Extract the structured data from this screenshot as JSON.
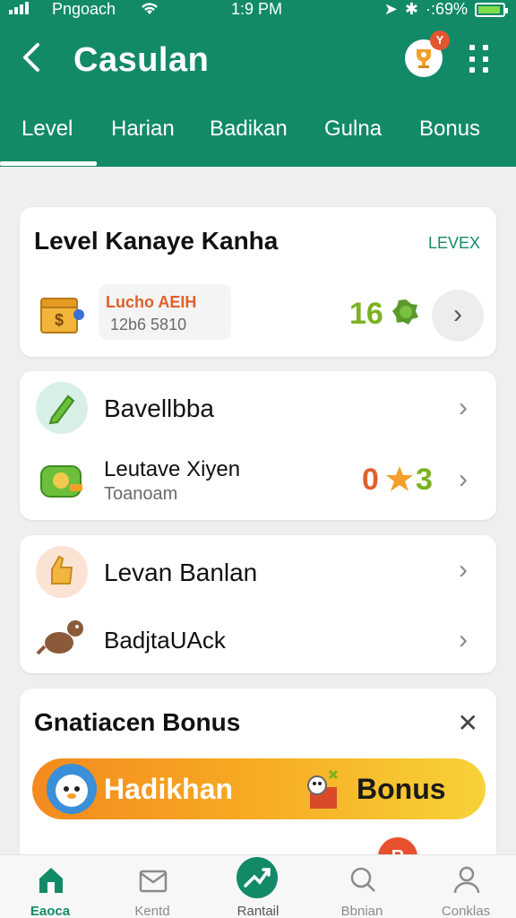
{
  "status_bar": {
    "carrier": "Pngoach",
    "time": "1:9 PM",
    "battery": "·:69%"
  },
  "header": {
    "title": "Casulan",
    "tabs": [
      {
        "label": "Level",
        "active": true
      },
      {
        "label": "Harian",
        "active": false
      },
      {
        "label": "Badikan",
        "active": false
      },
      {
        "label": "Gulna",
        "active": false
      },
      {
        "label": "Bonus",
        "active": false
      }
    ],
    "notification_badge": "Y"
  },
  "level_card": {
    "title": "Level Kanaye Kanha",
    "action": "LEVEX",
    "item_label": "Lucho AEIH",
    "item_sub": " 12b6 5810",
    "value": "16"
  },
  "list_group_1": [
    {
      "label": "Bavellbba",
      "sub": "",
      "value": "",
      "icon": "pencil-icon"
    },
    {
      "label": "Leutave Xiyen",
      "sub": "Toanoam",
      "value_left": "0",
      "value_right": "3",
      "icon": "money-bag-icon"
    }
  ],
  "list_group_2": [
    {
      "label": "Levan Banlan",
      "icon": "thumbs-up-icon"
    },
    {
      "label": "BadjtaUAck",
      "icon": "animal-icon"
    }
  ],
  "bonus_card": {
    "title": "Gnatiacen Bonus",
    "left_label": "Hadikhan",
    "right_label": "Bonus"
  },
  "bottom_nav": [
    {
      "label": "Eaoca",
      "icon": "home-icon",
      "active": true
    },
    {
      "label": "Kentd",
      "icon": "mail-icon",
      "active": false
    },
    {
      "label": "Rantail",
      "icon": "trend-icon",
      "active": false
    },
    {
      "label": "Bbnian",
      "icon": "search-icon",
      "active": false
    },
    {
      "label": "Conklas",
      "icon": "user-icon",
      "active": false
    }
  ],
  "fab_label": "R",
  "colors": {
    "brand_green": "#138a67",
    "accent_orange": "#f38a1e",
    "value_green": "#7bb21f"
  }
}
